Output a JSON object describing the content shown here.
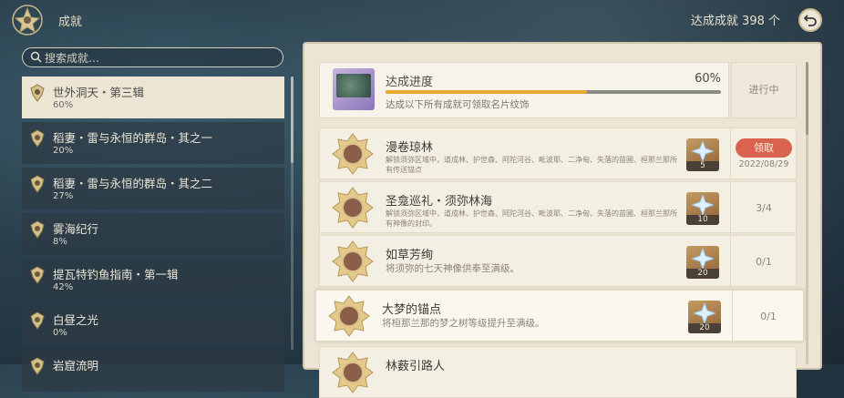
{
  "header": {
    "title": "成就",
    "count_label": "达成成就 398 个"
  },
  "search": {
    "placeholder": "搜索成就…"
  },
  "categories": [
    {
      "name": "世外洞天・第三辑",
      "pct": "60%"
    },
    {
      "name": "稻妻・雷与永恒的群岛・其之一",
      "pct": "20%"
    },
    {
      "name": "稻妻・雷与永恒的群岛・其之二",
      "pct": "27%"
    },
    {
      "name": "雾海纪行",
      "pct": "8%"
    },
    {
      "name": "提瓦特钓鱼指南・第一辑",
      "pct": "42%"
    },
    {
      "name": "白昼之光",
      "pct": "0%"
    },
    {
      "name": "岩窟流明",
      "pct": ""
    }
  ],
  "progress": {
    "title": "达成进度",
    "percent_text": "60%",
    "percent": 60,
    "desc": "达成以下所有成就可领取名片纹饰",
    "status": "进行中"
  },
  "achievements": [
    {
      "name": "漫卷琼林",
      "desc": "解锁须弥区域中，道成林、护世森、阿陀河谷、毗波耶、二净甸、失落的苗圃、桓那兰那所有传送锚点",
      "reward": "5",
      "claim": "领取",
      "date": "2022/08/29"
    },
    {
      "name": "圣龛巡礼・须弥林海",
      "desc": "解锁须弥区域中，道成林、护世森、阿陀河谷、毗波耶、二净甸、失落的苗圃、桓那兰那所有神像的封印。",
      "reward": "10",
      "status": "3/4"
    },
    {
      "name": "如草芳绚",
      "desc": "将须弥的七天神像供奉至满级。",
      "reward": "20",
      "status": "0/1"
    },
    {
      "name": "大梦的锚点",
      "desc": "将桓那兰那的梦之树等级提升至满级。",
      "reward": "20",
      "status": "0/1"
    },
    {
      "name": "林薮引路人",
      "desc": "",
      "reward": "",
      "status": ""
    }
  ],
  "colors": {
    "accent": "#e6a82f",
    "claim": "#d9634e",
    "panel": "#ece5d5"
  }
}
